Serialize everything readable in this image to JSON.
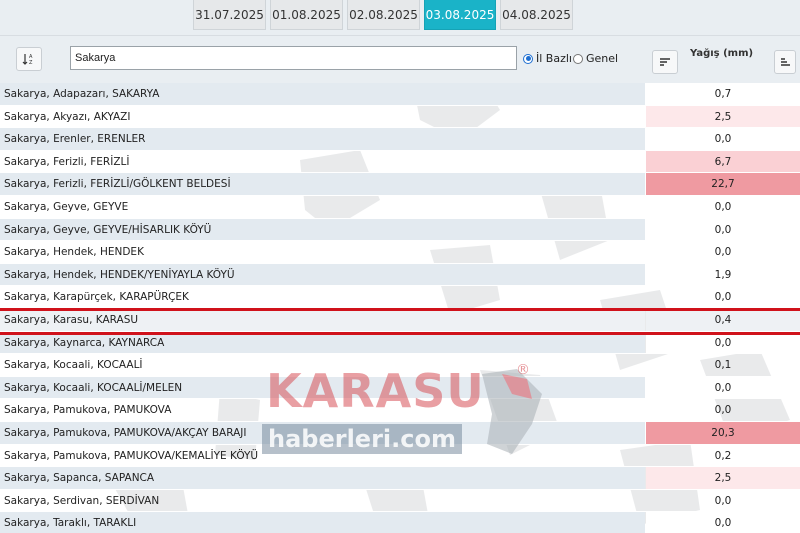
{
  "dates": [
    "31.07.2025",
    "01.08.2025",
    "02.08.2025",
    "03.08.2025",
    "04.08.2025"
  ],
  "active_date": "03.08.2025",
  "search": {
    "value": "Sakarya"
  },
  "filters": {
    "option1": "İl Bazlı",
    "option2": "Genel",
    "selected": "İl Bazlı"
  },
  "column_header": "Yağış (mm)",
  "rows": [
    {
      "name": "Sakarya, Adapazarı, SAKARYA",
      "value": "0,7"
    },
    {
      "name": "Sakarya, Akyazı, AKYAZI",
      "value": "2,5"
    },
    {
      "name": "Sakarya, Erenler, ERENLER",
      "value": "0,0"
    },
    {
      "name": "Sakarya, Ferizli, FERİZLİ",
      "value": "6,7"
    },
    {
      "name": "Sakarya, Ferizli, FERİZLİ/GÖLKENT BELDESİ",
      "value": "22,7"
    },
    {
      "name": "Sakarya, Geyve, GEYVE",
      "value": "0,0"
    },
    {
      "name": "Sakarya, Geyve, GEYVE/HİSARLIK KÖYÜ",
      "value": "0,0"
    },
    {
      "name": "Sakarya, Hendek, HENDEK",
      "value": "0,0"
    },
    {
      "name": "Sakarya, Hendek, HENDEK/YENİYAYLA KÖYÜ",
      "value": "1,9"
    },
    {
      "name": "Sakarya, Karapürçek, KARAPÜRÇEK",
      "value": "0,0"
    },
    {
      "name": "Sakarya, Karasu, KARASU",
      "value": "0,4"
    },
    {
      "name": "Sakarya, Kaynarca, KAYNARCA",
      "value": "0,0"
    },
    {
      "name": "Sakarya, Kocaali, KOCAALİ",
      "value": "0,1"
    },
    {
      "name": "Sakarya, Kocaali, KOCAALİ/MELEN",
      "value": "0,0"
    },
    {
      "name": "Sakarya, Pamukova, PAMUKOVA",
      "value": "0,0"
    },
    {
      "name": "Sakarya, Pamukova, PAMUKOVA/AKÇAY BARAJI",
      "value": "20,3"
    },
    {
      "name": "Sakarya, Pamukova, PAMUKOVA/KEMALİYE KÖYÜ",
      "value": "0,2"
    },
    {
      "name": "Sakarya, Sapanca, SAPANCA",
      "value": "2,5"
    },
    {
      "name": "Sakarya, Serdivan, SERDİVAN",
      "value": "0,0"
    },
    {
      "name": "Sakarya, Taraklı, TARAKLI",
      "value": "0,0"
    }
  ],
  "highlighted_row": "Sakarya, Karasu, KARASU",
  "watermark": {
    "line1": "KARASU",
    "line2": "haberleri.com",
    "mark": "®"
  },
  "colors": {
    "accent": "#1ab3c8",
    "highlight_line": "#d0121b",
    "rain_high": "#ef9aa1",
    "rain_mid": "#fad0d4",
    "rain_low": "#fde8ea"
  }
}
